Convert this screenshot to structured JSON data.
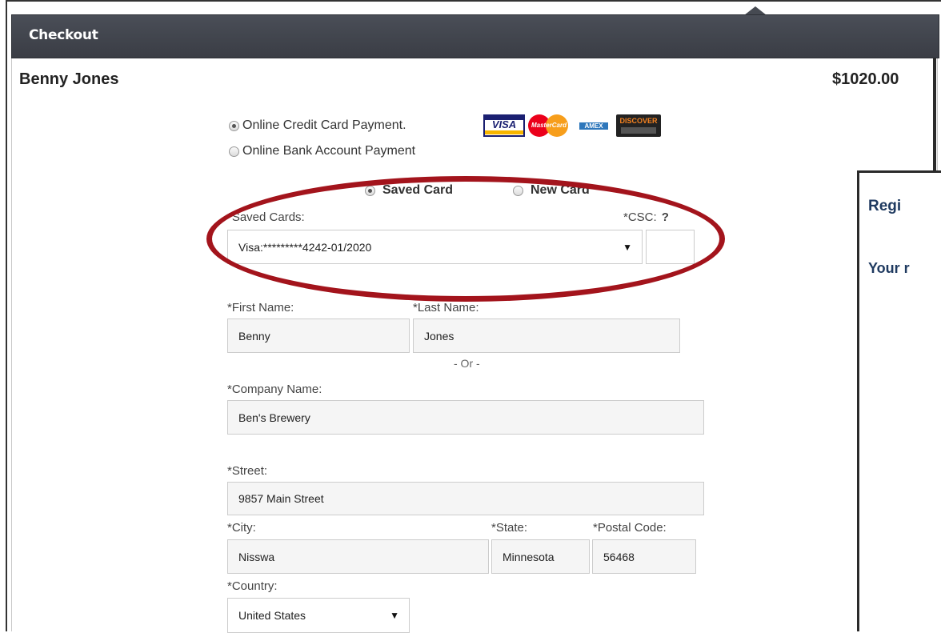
{
  "window": {
    "title": "Checkout"
  },
  "order": {
    "customer_name": "Benny Jones",
    "total": "$1020.00"
  },
  "payment_methods": [
    {
      "label": "Online Credit Card Payment.",
      "selected": true
    },
    {
      "label": "Online Bank Account Payment",
      "selected": false
    }
  ],
  "card_logos": {
    "visa": "VISA",
    "mastercard": "MasterCard",
    "amex": "AMEX",
    "discover": "DISCOVER"
  },
  "card_source": {
    "saved_label": "Saved Card",
    "new_label": "New Card",
    "selected": "saved"
  },
  "saved_cards": {
    "label": "*Saved Cards:",
    "value": "Visa:*********4242-01/2020"
  },
  "csc": {
    "label": "*CSC:",
    "help": "?",
    "value": ""
  },
  "first_name": {
    "label": "*First Name:",
    "value": "Benny"
  },
  "last_name": {
    "label": "*Last Name:",
    "value": "Jones"
  },
  "or_separator": "- Or -",
  "company_name": {
    "label": "*Company Name:",
    "value": "Ben's Brewery"
  },
  "street": {
    "label": "*Street:",
    "value": "9857 Main Street"
  },
  "city": {
    "label": "*City:",
    "value": "Nisswa"
  },
  "state": {
    "label": "*State:",
    "value": "Minnesota"
  },
  "postal_code": {
    "label": "*Postal Code:",
    "value": "56468"
  },
  "country": {
    "label": "*Country:",
    "value": "United States"
  },
  "side_panel": {
    "title": "Regi",
    "subtitle": "Your r"
  },
  "colors": {
    "header_bg": "#3f434b",
    "highlight_ellipse": "#a3141c",
    "side_panel_text": "#1f3a60"
  },
  "icons": {
    "dropdown": "▼"
  }
}
